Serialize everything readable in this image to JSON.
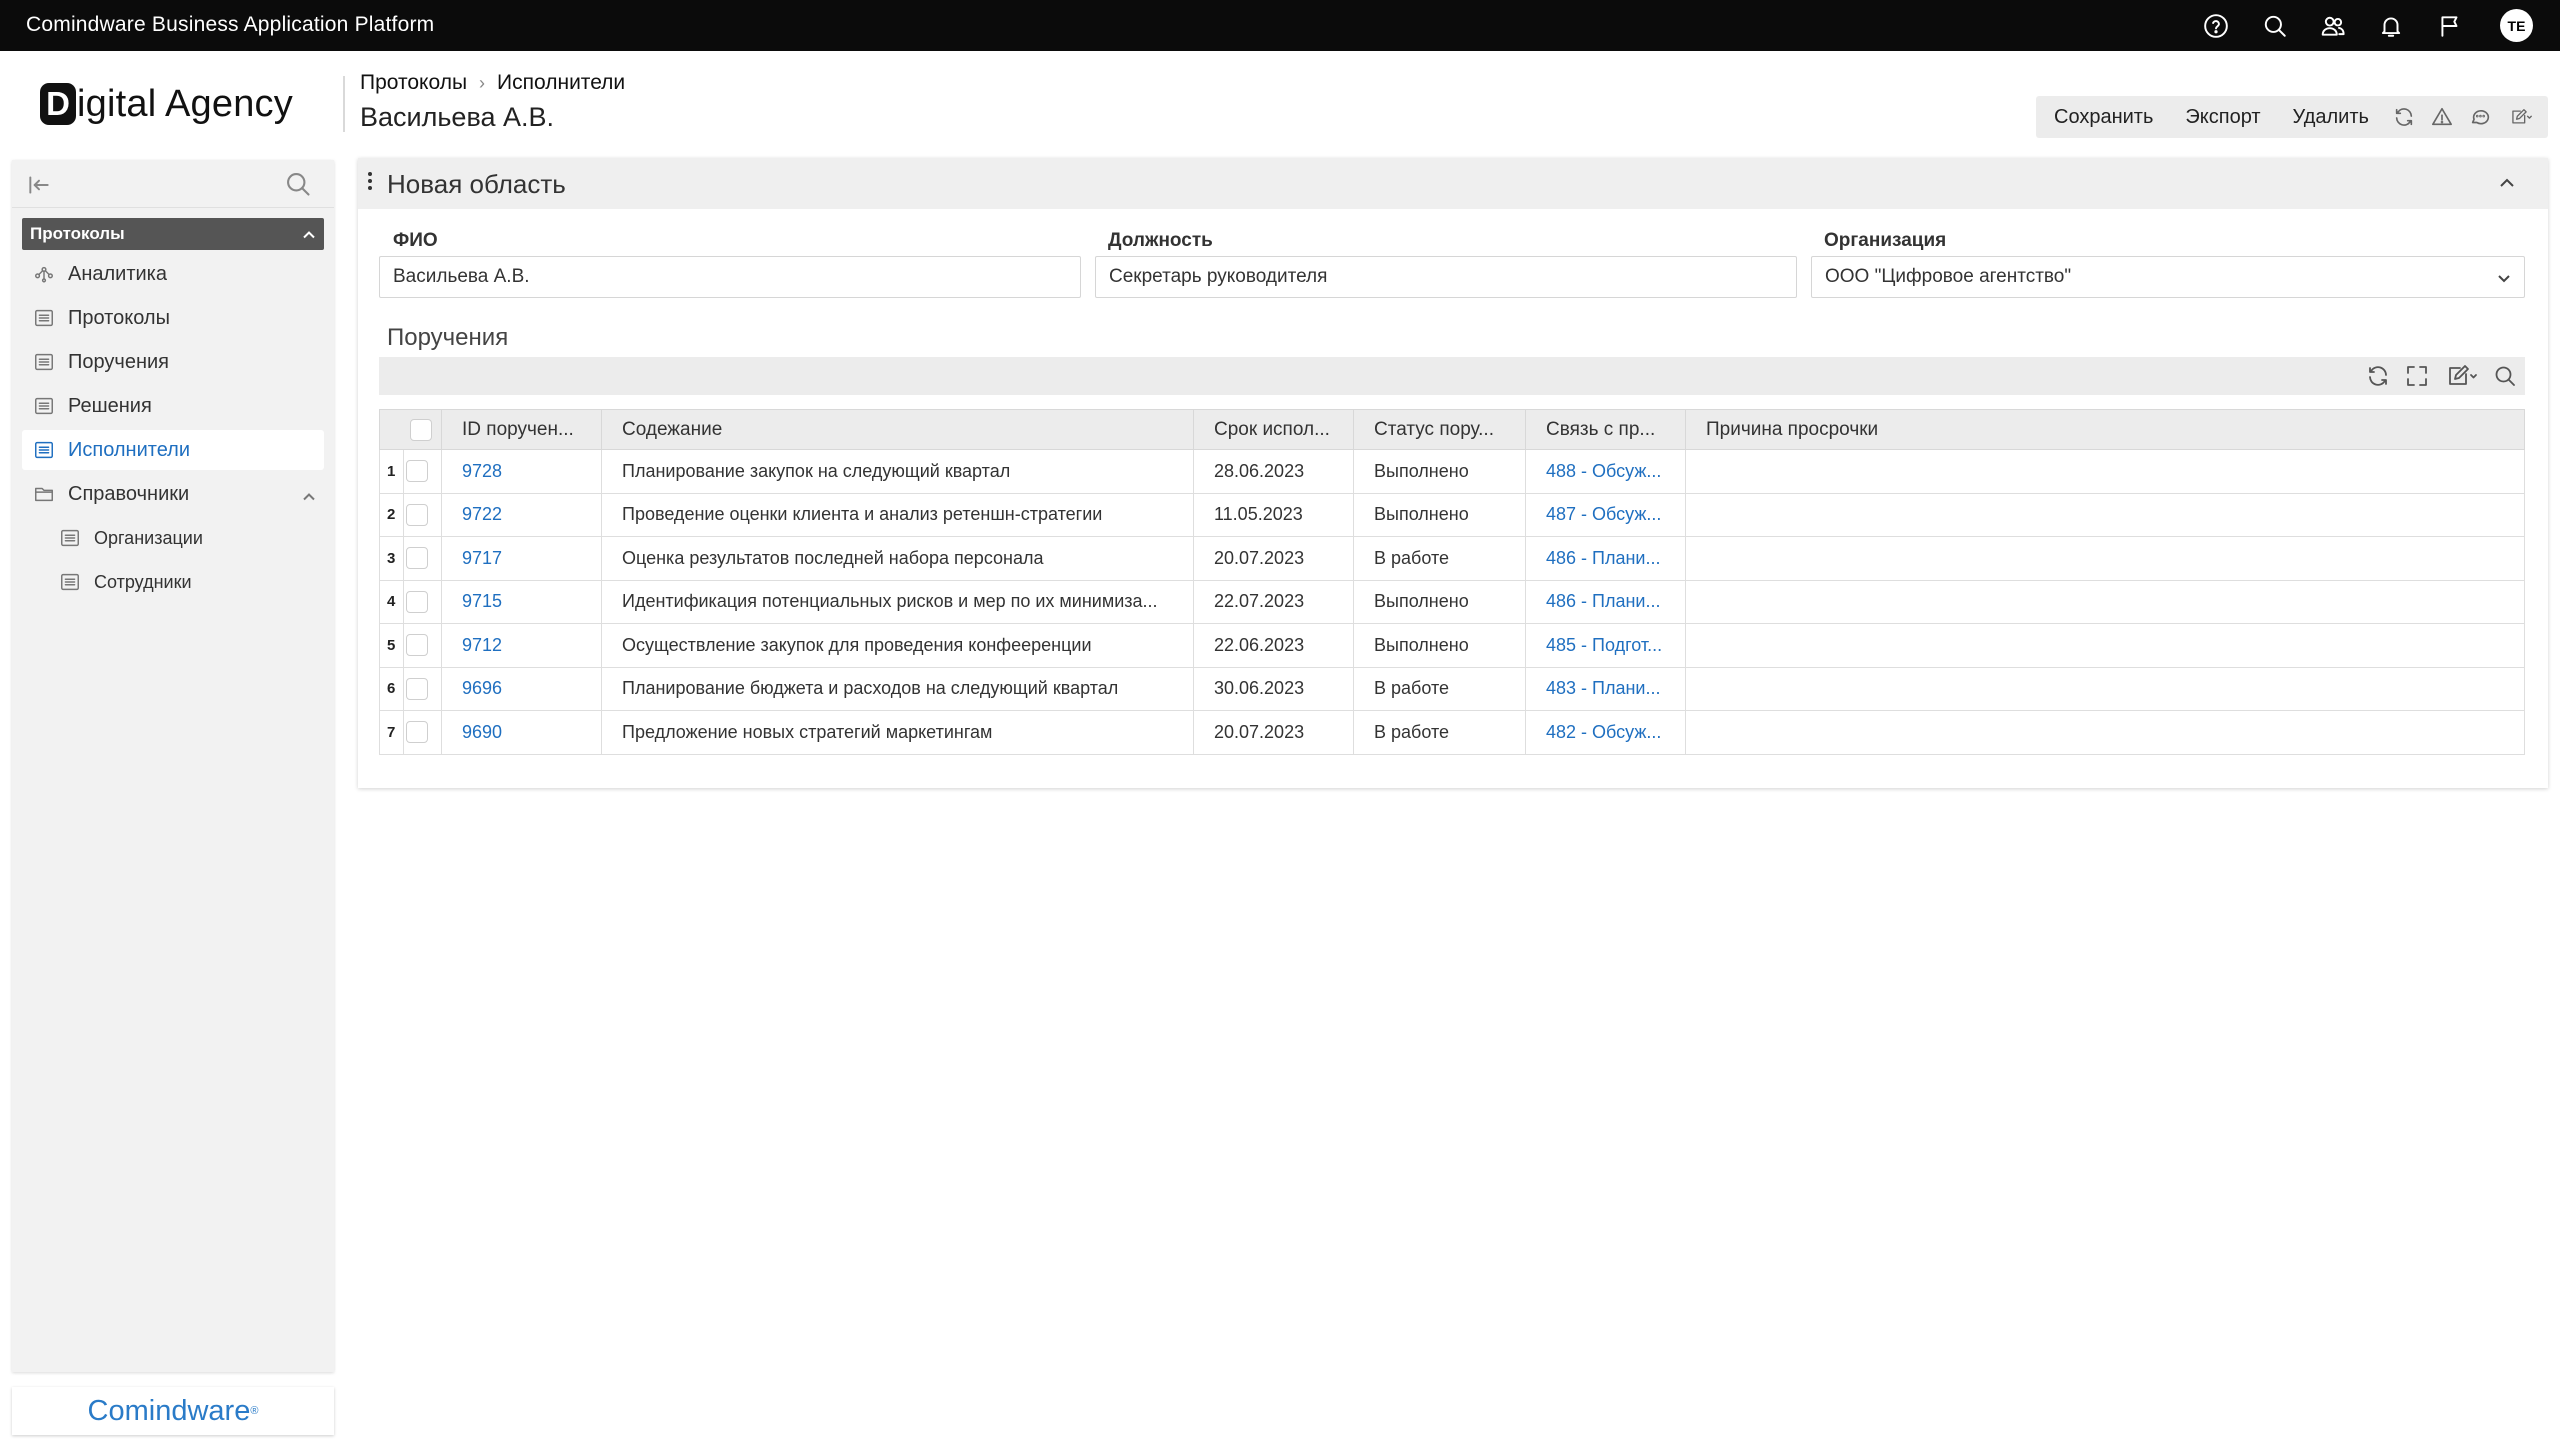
{
  "app": {
    "title": "Comindware Business Application Platform",
    "avatar_initials": "TE"
  },
  "logo": {
    "letter": "D",
    "rest": "igital Agency"
  },
  "breadcrumb": {
    "items": [
      "Протоколы",
      "Исполнители"
    ]
  },
  "page": {
    "title": "Васильева А.В."
  },
  "toolbar": {
    "save": "Сохранить",
    "export": "Экспорт",
    "delete": "Удалить"
  },
  "sidebar": {
    "section": "Протоколы",
    "items": [
      {
        "label": "Аналитика",
        "icon": "analytics-icon"
      },
      {
        "label": "Протоколы",
        "icon": "list-icon"
      },
      {
        "label": "Поручения",
        "icon": "list-icon"
      },
      {
        "label": "Решения",
        "icon": "list-icon"
      },
      {
        "label": "Исполнители",
        "icon": "list-icon",
        "active": true
      },
      {
        "label": "Справочники",
        "icon": "folder-icon"
      },
      {
        "label": "Организации",
        "icon": "list-icon"
      },
      {
        "label": "Сотрудники",
        "icon": "list-icon"
      }
    ],
    "brand": "Comindware"
  },
  "panel": {
    "title": "Новая область",
    "fields": {
      "fio": {
        "label": "ФИО",
        "value": "Васильева А.В."
      },
      "position": {
        "label": "Должность",
        "value": "Секретарь руководителя"
      },
      "organization": {
        "label": "Организация",
        "value": "ООО \"Цифровое агентство\""
      }
    },
    "subtable_title": "Поручения"
  },
  "grid": {
    "columns": [
      "ID поручен...",
      "Содежание",
      "Срок испол...",
      "Статус пору...",
      "Связь с пр...",
      "Причина просрочки"
    ],
    "rows": [
      {
        "n": "1",
        "id": "9728",
        "content": "Планирование закупок на следующий квартал",
        "due": "28.06.2023",
        "status": "Выполнено",
        "link": "488 - Обсуж...",
        "reason": ""
      },
      {
        "n": "2",
        "id": "9722",
        "content": "Проведение оценки клиента и анализ ретеншн-стратегии",
        "due": "11.05.2023",
        "status": "Выполнено",
        "link": "487 - Обсуж...",
        "reason": ""
      },
      {
        "n": "3",
        "id": "9717",
        "content": "Оценка результатов последней набора персонала",
        "due": "20.07.2023",
        "status": "В работе",
        "link": "486 - Плани...",
        "reason": ""
      },
      {
        "n": "4",
        "id": "9715",
        "content": "Идентификация потенциальных рисков и мер по их минимиза...",
        "due": "22.07.2023",
        "status": "Выполнено",
        "link": "486 - Плани...",
        "reason": ""
      },
      {
        "n": "5",
        "id": "9712",
        "content": "Осуществление закупок для проведения конфееренции",
        "due": "22.06.2023",
        "status": "Выполнено",
        "link": "485 - Подгот...",
        "reason": ""
      },
      {
        "n": "6",
        "id": "9696",
        "content": "Планирование бюджета и расходов на следующий квартал",
        "due": "30.06.2023",
        "status": "В работе",
        "link": "483 - Плани...",
        "reason": ""
      },
      {
        "n": "7",
        "id": "9690",
        "content": "Предложение новых стратегий маркетингам",
        "due": "20.07.2023",
        "status": "В работе",
        "link": "482 - Обсуж...",
        "reason": ""
      }
    ]
  },
  "colors": {
    "accent": "#1f6fc0",
    "topbar": "#0b0b0b",
    "section": "#555555"
  }
}
